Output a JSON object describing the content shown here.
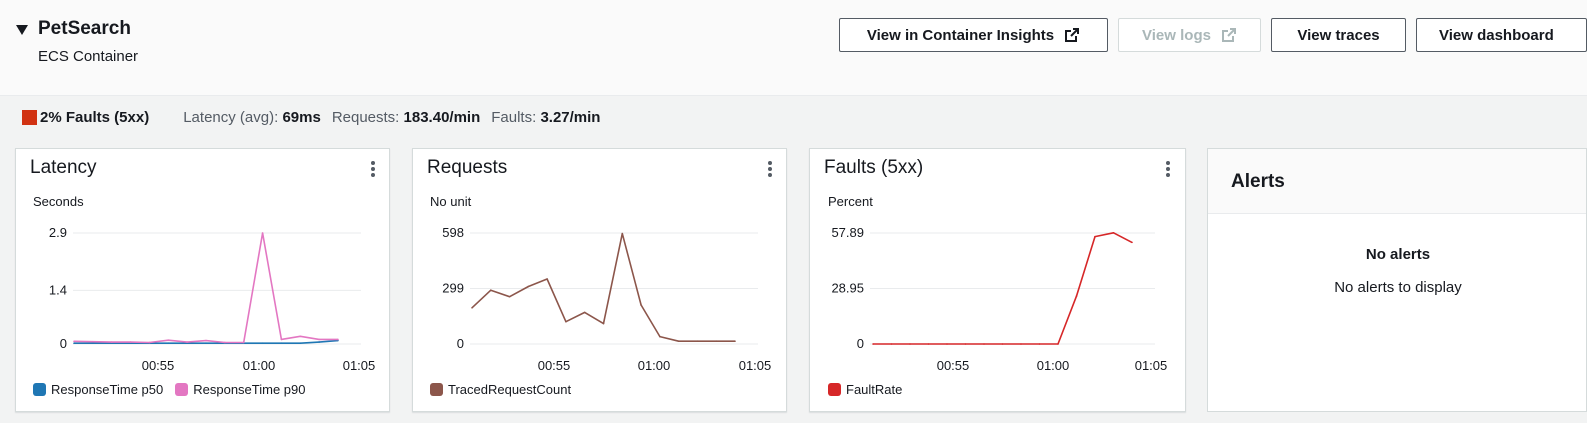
{
  "header": {
    "title": "PetSearch",
    "subtitle": "ECS Container",
    "buttons": {
      "container_insights": "View in Container Insights",
      "logs": "View logs",
      "traces": "View traces",
      "dashboard": "View dashboard"
    }
  },
  "summary": {
    "faults_badge": "2% Faults (5xx)",
    "latency_label": "Latency (avg):",
    "latency_value": "69ms",
    "requests_label": "Requests:",
    "requests_value": "183.40/min",
    "faults_label": "Faults:",
    "faults_value": "3.27/min",
    "fault_color": "#d13212"
  },
  "alerts": {
    "title": "Alerts",
    "empty_title": "No alerts",
    "empty_text": "No alerts to display"
  },
  "chart_data": [
    {
      "type": "line",
      "title": "Latency",
      "ylabel": "Seconds",
      "ylim": [
        0,
        2.9
      ],
      "yticks": [
        0,
        1.4,
        2.9
      ],
      "ytick_labels": [
        "0",
        "1.4",
        "2.9"
      ],
      "x": [
        "00:50",
        "00:51",
        "00:52",
        "00:53",
        "00:54",
        "00:55",
        "00:56",
        "00:57",
        "00:58",
        "00:59",
        "01:00",
        "01:01",
        "01:02",
        "01:03",
        "01:04"
      ],
      "xticks": [
        "00:55",
        "01:00",
        "01:05"
      ],
      "grid": true,
      "legend": "bottom",
      "series": [
        {
          "name": "ResponseTime p50",
          "color": "#1f77b4",
          "values": [
            0.02,
            0.02,
            0.02,
            0.02,
            0.02,
            0.02,
            0.02,
            0.02,
            0.02,
            0.02,
            0.02,
            0.02,
            0.02,
            0.05,
            0.09
          ]
        },
        {
          "name": "ResponseTime p90",
          "color": "#e377c2",
          "values": [
            0.07,
            0.06,
            0.05,
            0.05,
            0.04,
            0.1,
            0.05,
            0.09,
            0.04,
            0.04,
            2.9,
            0.12,
            0.2,
            0.12,
            0.12
          ]
        }
      ]
    },
    {
      "type": "line",
      "title": "Requests",
      "ylabel": "No unit",
      "ylim": [
        0,
        598
      ],
      "yticks": [
        0,
        299,
        598
      ],
      "ytick_labels": [
        "0",
        "299",
        "598"
      ],
      "x": [
        "00:50",
        "00:51",
        "00:52",
        "00:53",
        "00:54",
        "00:55",
        "00:56",
        "00:57",
        "00:58",
        "00:59",
        "01:00",
        "01:01",
        "01:02",
        "01:03",
        "01:04"
      ],
      "xticks": [
        "00:55",
        "01:00",
        "01:05"
      ],
      "grid": true,
      "legend": "bottom",
      "series": [
        {
          "name": "TracedRequestCount",
          "color": "#8c564b",
          "values": [
            195,
            290,
            255,
            310,
            350,
            120,
            170,
            110,
            595,
            210,
            40,
            15,
            15,
            15,
            15
          ]
        }
      ]
    },
    {
      "type": "line",
      "title": "Faults (5xx)",
      "ylabel": "Percent",
      "ylim": [
        0,
        57.89
      ],
      "yticks": [
        0,
        28.95,
        57.89
      ],
      "ytick_labels": [
        "0",
        "28.95",
        "57.89"
      ],
      "x": [
        "00:50",
        "00:51",
        "00:52",
        "00:53",
        "00:54",
        "00:55",
        "00:56",
        "00:57",
        "00:58",
        "00:59",
        "01:00",
        "01:01",
        "01:02",
        "01:03",
        "01:04"
      ],
      "xticks": [
        "00:55",
        "01:00",
        "01:05"
      ],
      "grid": true,
      "legend": "bottom",
      "series": [
        {
          "name": "FaultRate",
          "color": "#d62728",
          "values": [
            0,
            0,
            0,
            0,
            0,
            0,
            0,
            0,
            0,
            0,
            0,
            25,
            56,
            58,
            53
          ]
        }
      ]
    }
  ]
}
